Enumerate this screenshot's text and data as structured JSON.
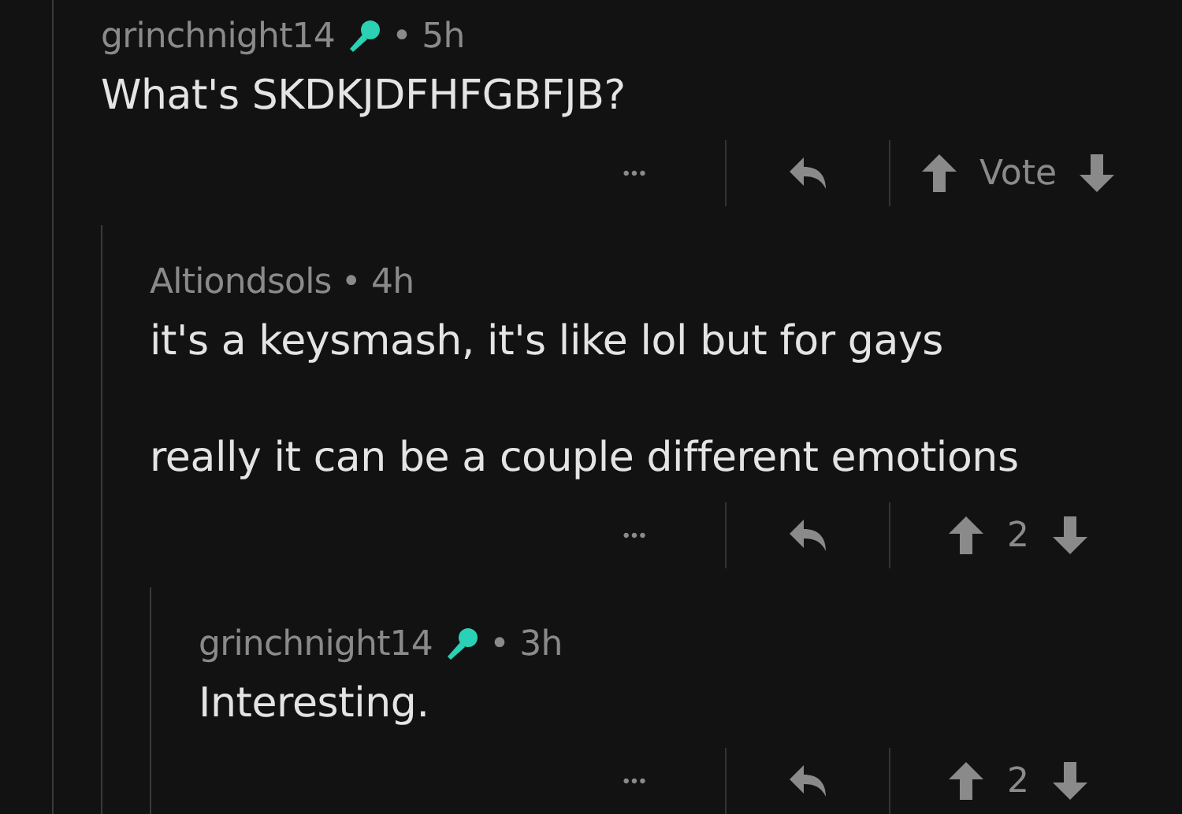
{
  "comments": [
    {
      "author": "grinchnight14",
      "mic_badge": true,
      "time": "5h",
      "separator": "•",
      "body": [
        "What's SKDKJDFHFGBFJB?"
      ],
      "more": "•••",
      "score": "Vote",
      "children": [
        {
          "author": "Altiondsols",
          "mic_badge": false,
          "time": "4h",
          "separator": "•",
          "body": [
            "it's a keysmash, it's like lol but for gays",
            "really it can be a couple different emotions"
          ],
          "more": "•••",
          "score": "2",
          "children": [
            {
              "author": "grinchnight14",
              "mic_badge": true,
              "time": "3h",
              "separator": "•",
              "body": [
                "Interesting."
              ],
              "more": "•••",
              "score": "2"
            }
          ]
        }
      ]
    }
  ]
}
